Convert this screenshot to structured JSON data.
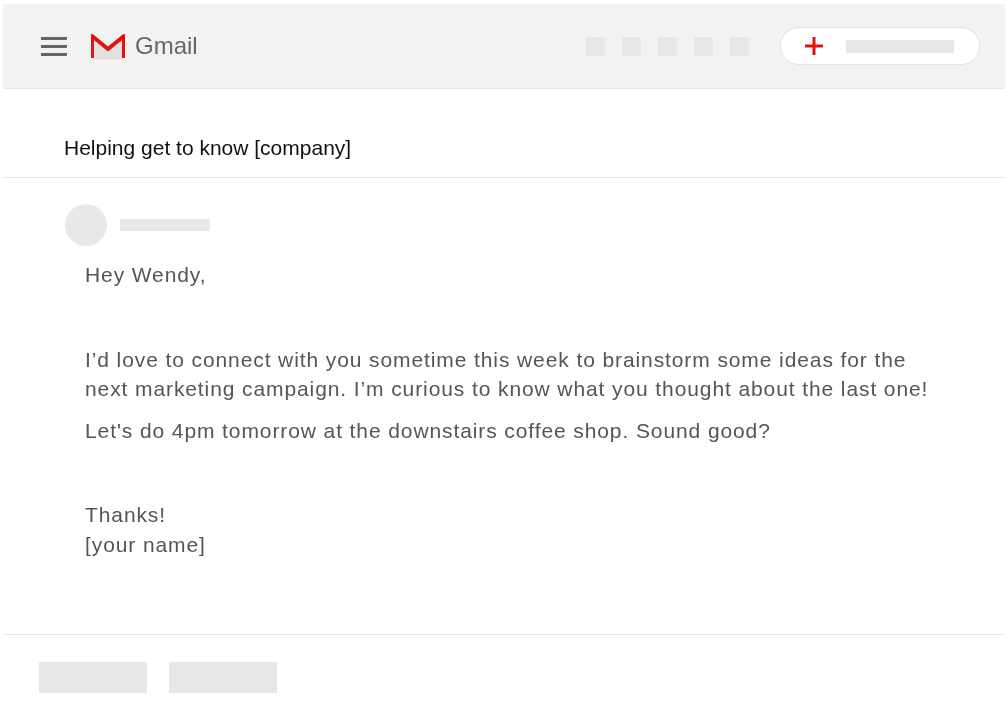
{
  "app_bar": {
    "app_name": "Gmail"
  },
  "subject": "Helping get to know [company]",
  "message": {
    "paragraphs": [
      {
        "lines": [
          "Hey Wendy,"
        ]
      },
      {
        "lines": [
          "I’d love to connect with you sometime this week to brainstorm some ideas for the next marketing campaign. I’m curious to know what you thought about the last one!"
        ]
      },
      {
        "lines": [
          "Let's do 4pm tomorrow at the downstairs coffee shop. Sound good?"
        ]
      },
      {
        "lines": [
          "Thanks!",
          "[your name]"
        ]
      }
    ]
  }
}
